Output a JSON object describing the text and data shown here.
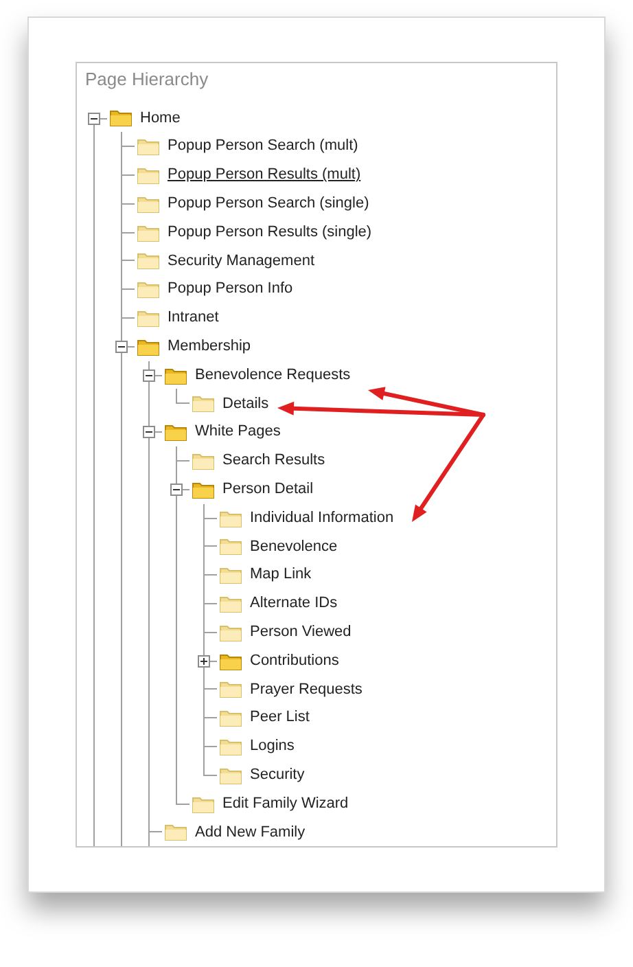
{
  "panel": {
    "title": "Page Hierarchy"
  },
  "tree_cut_off": true,
  "tree": [
    {
      "label": "Home",
      "expanded": true,
      "hovered": false,
      "children": [
        {
          "label": "Popup Person Search (mult)",
          "hovered": false
        },
        {
          "label": "Popup Person Results (mult)",
          "hovered": true
        },
        {
          "label": "Popup Person Search (single)",
          "hovered": false
        },
        {
          "label": "Popup Person Results (single)",
          "hovered": false
        },
        {
          "label": "Security Management",
          "hovered": false
        },
        {
          "label": "Popup Person Info",
          "hovered": false
        },
        {
          "label": "Intranet",
          "hovered": false
        },
        {
          "label": "Membership",
          "expanded": true,
          "hovered": false,
          "children": [
            {
              "label": "Benevolence Requests",
              "expanded": true,
              "hovered": false,
              "children": [
                {
                  "label": "Details",
                  "hovered": false
                }
              ]
            },
            {
              "label": "White Pages",
              "expanded": true,
              "hovered": false,
              "children": [
                {
                  "label": "Search Results",
                  "hovered": false
                },
                {
                  "label": "Person Detail",
                  "expanded": true,
                  "hovered": false,
                  "children": [
                    {
                      "label": "Individual Information",
                      "hovered": false
                    },
                    {
                      "label": "Benevolence",
                      "hovered": false
                    },
                    {
                      "label": "Map Link",
                      "hovered": false
                    },
                    {
                      "label": "Alternate IDs",
                      "hovered": false
                    },
                    {
                      "label": "Person Viewed",
                      "hovered": false
                    },
                    {
                      "label": "Contributions",
                      "expanded": false,
                      "hovered": false
                    },
                    {
                      "label": "Prayer Requests",
                      "hovered": false
                    },
                    {
                      "label": "Peer List",
                      "hovered": false
                    },
                    {
                      "label": "Logins",
                      "hovered": false
                    },
                    {
                      "label": "Security",
                      "hovered": false
                    }
                  ]
                },
                {
                  "label": "Edit Family Wizard",
                  "hovered": false
                }
              ]
            },
            {
              "label": "Add New Family",
              "hovered": false
            }
          ]
        }
      ]
    }
  ]
}
